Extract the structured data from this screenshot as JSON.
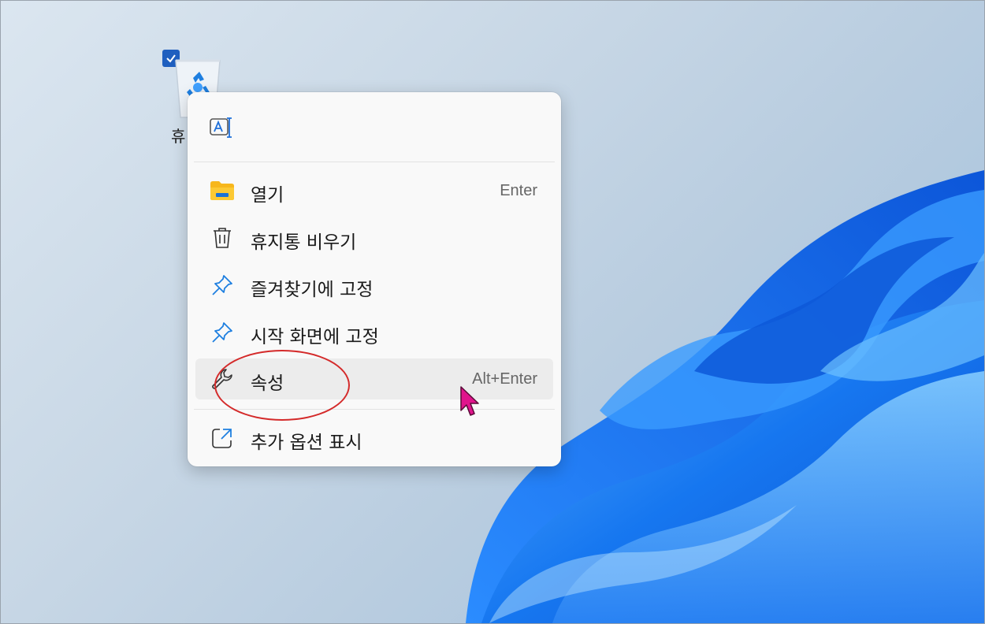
{
  "desktop": {
    "recycle_bin_label": "휴"
  },
  "context_menu": {
    "rename_icon": "rename-icon",
    "items": [
      {
        "label": "열기",
        "shortcut": "Enter",
        "icon": "folder-icon"
      },
      {
        "label": "휴지통 비우기",
        "shortcut": "",
        "icon": "trash-icon"
      },
      {
        "label": "즐겨찾기에 고정",
        "shortcut": "",
        "icon": "pin-icon"
      },
      {
        "label": "시작 화면에 고정",
        "shortcut": "",
        "icon": "pin-icon"
      },
      {
        "label": "속성",
        "shortcut": "Alt+Enter",
        "icon": "wrench-icon"
      },
      {
        "label": "추가 옵션 표시",
        "shortcut": "",
        "icon": "share-icon"
      }
    ],
    "highlighted_item": "속성"
  },
  "colors": {
    "accent_blue": "#1f5fbf",
    "annotation_red": "#d42a2a",
    "cursor_magenta": "#e0148c"
  }
}
